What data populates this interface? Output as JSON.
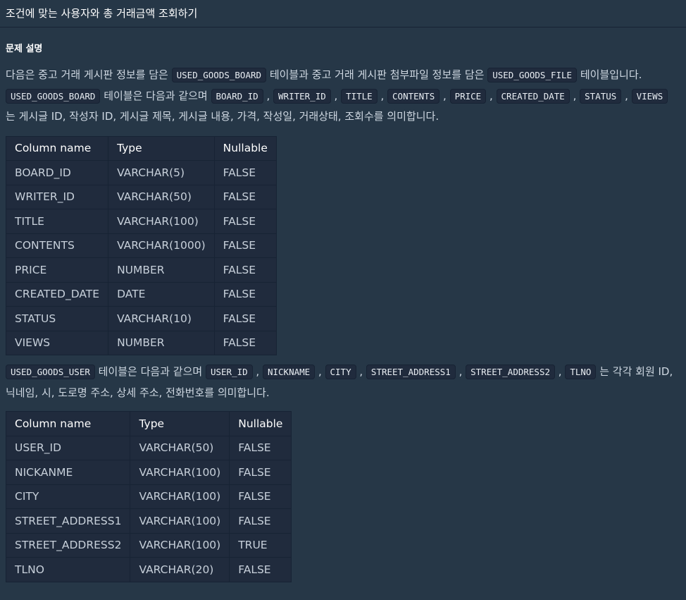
{
  "header": {
    "title": "조건에 맞는 사용자와 총 거래금액 조회하기"
  },
  "section": {
    "title": "문제 설명"
  },
  "para1": {
    "s1": "다음은 중고 거래 게시판 정보를 담은 ",
    "c1": "USED_GOODS_BOARD",
    "s2": " 테이블과 중고 거래 게시판 첨부파일 정보를 담은 ",
    "c2": "USED_GOODS_FILE",
    "s3": " 테이블입니다. ",
    "c3": "USED_GOODS_BOARD",
    "s4": " 테이블은 다음과 같으며 ",
    "c4": "BOARD_ID",
    "s5": " , ",
    "c5": "WRITER_ID",
    "s6": " , ",
    "c6": "TITLE",
    "s7": " , ",
    "c7": "CONTENTS",
    "s8": " , ",
    "c8": "PRICE",
    "s9": " , ",
    "c9": "CREATED_DATE",
    "s10": " , ",
    "c10": "STATUS",
    "s11": " , ",
    "c11": "VIEWS",
    "s12": " 는 게시글 ID, 작성자 ID, 게시글 제목, 게시글 내용, 가격, 작성일, 거래상태, 조회수를 의미합니다."
  },
  "table1": {
    "headers": [
      "Column name",
      "Type",
      "Nullable"
    ],
    "rows": [
      [
        "BOARD_ID",
        "VARCHAR(5)",
        "FALSE"
      ],
      [
        "WRITER_ID",
        "VARCHAR(50)",
        "FALSE"
      ],
      [
        "TITLE",
        "VARCHAR(100)",
        "FALSE"
      ],
      [
        "CONTENTS",
        "VARCHAR(1000)",
        "FALSE"
      ],
      [
        "PRICE",
        "NUMBER",
        "FALSE"
      ],
      [
        "CREATED_DATE",
        "DATE",
        "FALSE"
      ],
      [
        "STATUS",
        "VARCHAR(10)",
        "FALSE"
      ],
      [
        "VIEWS",
        "NUMBER",
        "FALSE"
      ]
    ]
  },
  "para2": {
    "c1": "USED_GOODS_USER",
    "s1": " 테이블은 다음과 같으며 ",
    "c2": "USER_ID",
    "s2": " , ",
    "c3": "NICKNAME",
    "s3": " , ",
    "c4": "CITY",
    "s4": " , ",
    "c5": "STREET_ADDRESS1",
    "s5": " , ",
    "c6": "STREET_ADDRESS2",
    "s6": " , ",
    "c7": "TLNO",
    "s7": " 는 각각 회원 ID, 닉네임, 시, 도로명 주소, 상세 주소, 전화번호를 의미합니다."
  },
  "table2": {
    "headers": [
      "Column name",
      "Type",
      "Nullable"
    ],
    "rows": [
      [
        "USER_ID",
        "VARCHAR(50)",
        "FALSE"
      ],
      [
        "NICKANME",
        "VARCHAR(100)",
        "FALSE"
      ],
      [
        "CITY",
        "VARCHAR(100)",
        "FALSE"
      ],
      [
        "STREET_ADDRESS1",
        "VARCHAR(100)",
        "FALSE"
      ],
      [
        "STREET_ADDRESS2",
        "VARCHAR(100)",
        "TRUE"
      ],
      [
        "TLNO",
        "VARCHAR(20)",
        "FALSE"
      ]
    ]
  },
  "colors": {
    "background": "#263747",
    "code_background": "#202b3d",
    "table_background": "#202b3d",
    "border": "#172334",
    "text": "#d5dde5"
  }
}
